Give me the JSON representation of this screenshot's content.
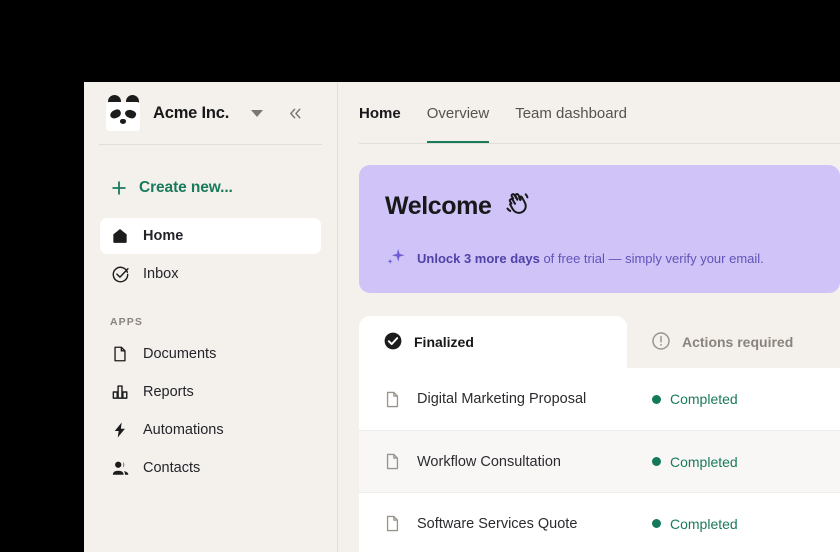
{
  "theme": {
    "accent_green": "#1a7a5c",
    "banner_purple": "#cfc3f7",
    "banner_text_purple": "#6154b8",
    "sidebar_bg": "#f4f1ed",
    "status_green": "#13795a"
  },
  "sidebar": {
    "workspace": {
      "name": "Acme Inc.",
      "logo_icon": "panda-logo-icon",
      "dropdown_icon": "caret-down-icon",
      "collapse_icon": "chevrons-left-icon"
    },
    "create_new": {
      "label": "Create new...",
      "icon": "plus-icon"
    },
    "primary_items": [
      {
        "label": "Home",
        "icon": "home-icon",
        "active": true
      },
      {
        "label": "Inbox",
        "icon": "check-circle-icon",
        "active": false
      }
    ],
    "apps_section_label": "APPS",
    "app_items": [
      {
        "label": "Documents",
        "icon": "file-icon"
      },
      {
        "label": "Reports",
        "icon": "bar-chart-icon"
      },
      {
        "label": "Automations",
        "icon": "lightning-bolt-icon"
      },
      {
        "label": "Contacts",
        "icon": "people-icon"
      }
    ]
  },
  "topnav": {
    "page_title": "Home",
    "tabs": [
      {
        "label": "Overview",
        "selected": true
      },
      {
        "label": "Team dashboard",
        "selected": false
      }
    ]
  },
  "welcome_banner": {
    "title": "Welcome",
    "title_icon": "waving-hand-icon",
    "sparkle_icon": "sparkle-icon",
    "trial_bold": "Unlock 3 more days",
    "trial_rest": " of free trial — simply verify your email."
  },
  "documents_panel": {
    "tabs": [
      {
        "label": "Finalized",
        "icon": "check-circle-filled-icon",
        "active": true
      },
      {
        "label": "Actions required",
        "icon": "alert-circle-icon",
        "active": false
      }
    ],
    "rows": [
      {
        "name": "Digital Marketing Proposal",
        "icon": "file-icon",
        "status": "Completed",
        "hover": false
      },
      {
        "name": "Workflow Consultation",
        "icon": "file-icon",
        "status": "Completed",
        "hover": true
      },
      {
        "name": "Software Services Quote",
        "icon": "file-icon",
        "status": "Completed",
        "hover": false
      }
    ]
  }
}
